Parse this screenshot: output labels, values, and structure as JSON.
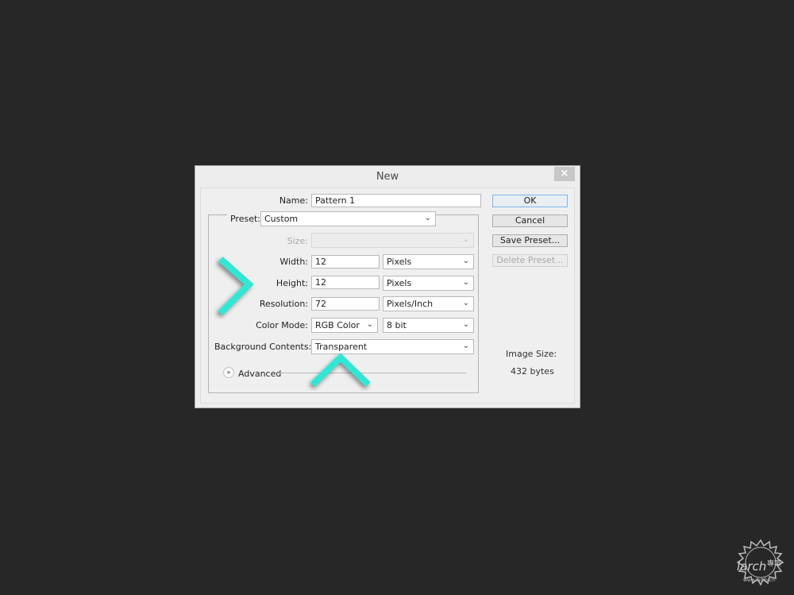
{
  "dialog": {
    "title": "New",
    "close_label": "×"
  },
  "form": {
    "name_label": "Name:",
    "name_value": "Pattern 1",
    "preset_label": "Preset:",
    "preset_value": "Custom",
    "size_label": "Size:",
    "size_value": "",
    "width_label": "Width:",
    "width_value": "12",
    "width_unit": "Pixels",
    "height_label": "Height:",
    "height_value": "12",
    "height_unit": "Pixels",
    "resolution_label": "Resolution:",
    "resolution_value": "72",
    "resolution_unit": "Pixels/Inch",
    "color_mode_label": "Color Mode:",
    "color_mode_value": "RGB Color",
    "bit_depth_value": "8 bit",
    "background_label": "Background Contents:",
    "background_value": "Transparent",
    "advanced_label": "Advanced"
  },
  "buttons": {
    "ok": "OK",
    "cancel": "Cancel",
    "save_preset": "Save Preset...",
    "delete_preset": "Delete Preset..."
  },
  "info": {
    "image_size_label": "Image Size:",
    "image_size_value": "432 bytes"
  },
  "annotations": {
    "arrow_color": "#2ee8d6"
  },
  "watermark": {
    "brand": "iarch",
    "chinese": "專築",
    "url": "www.iarch.cn"
  }
}
